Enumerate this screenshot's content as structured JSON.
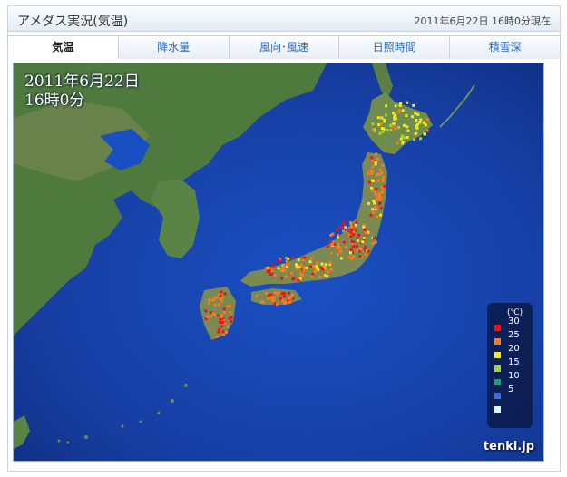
{
  "header": {
    "title": "アメダス実況(気温)",
    "timestamp": "2011年6月22日 16時0分現在"
  },
  "tabs": [
    {
      "label": "気温",
      "active": true
    },
    {
      "label": "降水量",
      "active": false
    },
    {
      "label": "風向･風速",
      "active": false
    },
    {
      "label": "日照時間",
      "active": false
    },
    {
      "label": "積雪深",
      "active": false
    }
  ],
  "map": {
    "date_line": "2011年6月22日",
    "time_line": "16時0分",
    "brand": "tenki.jp",
    "legend": {
      "unit": "(℃)",
      "items": [
        {
          "label": "30",
          "color": "#e8141c"
        },
        {
          "label": "25",
          "color": "#ff7a1a"
        },
        {
          "label": "20",
          "color": "#f2ea1e"
        },
        {
          "label": "15",
          "color": "#a8d22a"
        },
        {
          "label": "10",
          "color": "#1f9a7a"
        },
        {
          "label": "5",
          "color": "#3a6fe0"
        },
        {
          "label": "",
          "color": "#dff4ff"
        }
      ]
    }
  }
}
